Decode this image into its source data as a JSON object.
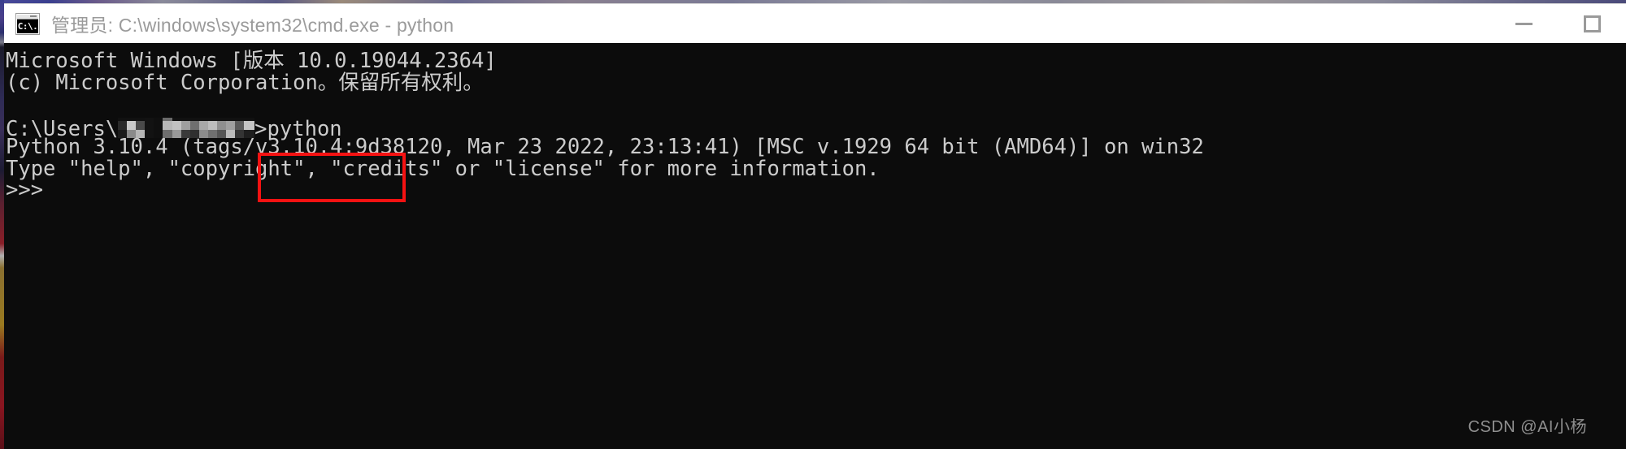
{
  "window": {
    "title": "管理员: C:\\windows\\system32\\cmd.exe - python",
    "icon_name": "cmd-console-icon",
    "icon_glyph": "C:\\.",
    "controls": {
      "minimize_label": "最小化",
      "maximize_label": "最大化"
    }
  },
  "console": {
    "background_color": "#0c0c0c",
    "text_color": "#cccccc",
    "lines": [
      "Microsoft Windows [版本 10.0.19044.2364]",
      "(c) Microsoft Corporation。保留所有权利。",
      ""
    ],
    "prompt": {
      "prefix": "C:\\Users\\",
      "censored_path": "",
      "suffix": ">",
      "command": "python"
    },
    "output": [
      "Python 3.10.4 (tags/v3.10.4:9d38120, Mar 23 2022, 23:13:41) [MSC v.1929 64 bit (AMD64)] on win32",
      "Type \"help\", \"copyright\", \"credits\" or \"license\" for more information."
    ],
    "repl_prompt": ">>>"
  },
  "annotation": {
    "highlight_color": "#f51212",
    "target": "python"
  },
  "watermark": {
    "text": "CSDN @AI小杨"
  }
}
